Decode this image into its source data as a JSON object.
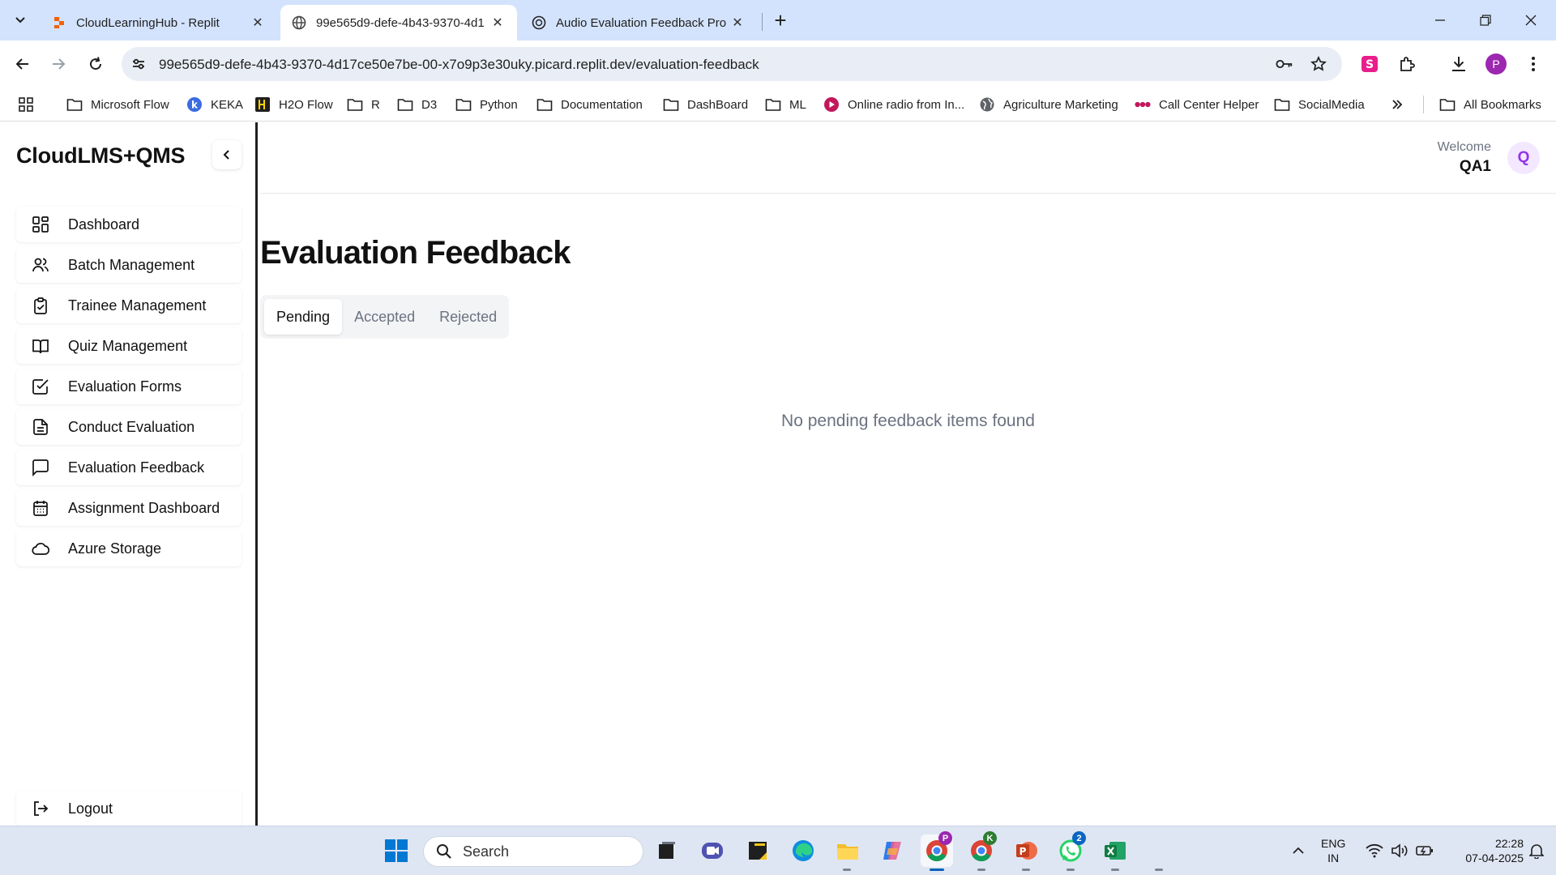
{
  "browser": {
    "tabs": [
      {
        "title": "CloudLearningHub - Replit",
        "active": false
      },
      {
        "title": "99e565d9-defe-4b43-9370-4d1",
        "active": true
      },
      {
        "title": "Audio Evaluation Feedback Pro",
        "active": false
      }
    ],
    "url": "99e565d9-defe-4b43-9370-4d17ce50e7be-00-x7o9p3e30uky.picard.replit.dev/evaluation-feedback",
    "profile_initial": "P",
    "bookmarks": [
      {
        "label": "Microsoft Flow",
        "icon": "folder-icon"
      },
      {
        "label": "KEKA",
        "icon": "keka-icon"
      },
      {
        "label": "H2O Flow",
        "icon": "h2o-icon"
      },
      {
        "label": "R",
        "icon": "folder-icon"
      },
      {
        "label": "D3",
        "icon": "folder-icon"
      },
      {
        "label": "Python",
        "icon": "folder-icon"
      },
      {
        "label": "Documentation",
        "icon": "folder-icon"
      },
      {
        "label": "DashBoard",
        "icon": "folder-icon"
      },
      {
        "label": "ML",
        "icon": "folder-icon"
      },
      {
        "label": "Online radio from In...",
        "icon": "radio-icon"
      },
      {
        "label": "Agriculture Marketing",
        "icon": "globe-icon"
      },
      {
        "label": "Call Center Helper",
        "icon": "dots-icon"
      },
      {
        "label": "SocialMedia",
        "icon": "folder-icon"
      }
    ],
    "all_bookmarks": "All Bookmarks"
  },
  "app": {
    "brand": "CloudLMS+QMS",
    "nav": [
      {
        "label": "Dashboard",
        "icon": "dashboard-icon"
      },
      {
        "label": "Batch Management",
        "icon": "users-icon"
      },
      {
        "label": "Trainee Management",
        "icon": "clipboard-check-icon"
      },
      {
        "label": "Quiz Management",
        "icon": "book-open-icon"
      },
      {
        "label": "Evaluation Forms",
        "icon": "check-square-icon"
      },
      {
        "label": "Conduct Evaluation",
        "icon": "file-text-icon"
      },
      {
        "label": "Evaluation Feedback",
        "icon": "message-square-icon"
      },
      {
        "label": "Assignment Dashboard",
        "icon": "calendar-icon"
      },
      {
        "label": "Azure Storage",
        "icon": "cloud-icon"
      }
    ],
    "logout": "Logout",
    "header": {
      "welcome": "Welcome",
      "user": "QA1",
      "avatar_initial": "Q"
    },
    "page_title": "Evaluation Feedback",
    "tabs": [
      "Pending",
      "Accepted",
      "Rejected"
    ],
    "active_tab": "Pending",
    "empty_message": "No pending feedback items found",
    "colors": {
      "avatar_bg": "#f3e8ff",
      "avatar_fg": "#9333ea"
    }
  },
  "taskbar": {
    "search_placeholder": "Search",
    "lang_1": "ENG",
    "lang_2": "IN",
    "time": "22:28",
    "date": "07-04-2025",
    "whatsapp_badge": "2",
    "chrome_p_badge": "P",
    "chrome_k_badge": "K"
  }
}
